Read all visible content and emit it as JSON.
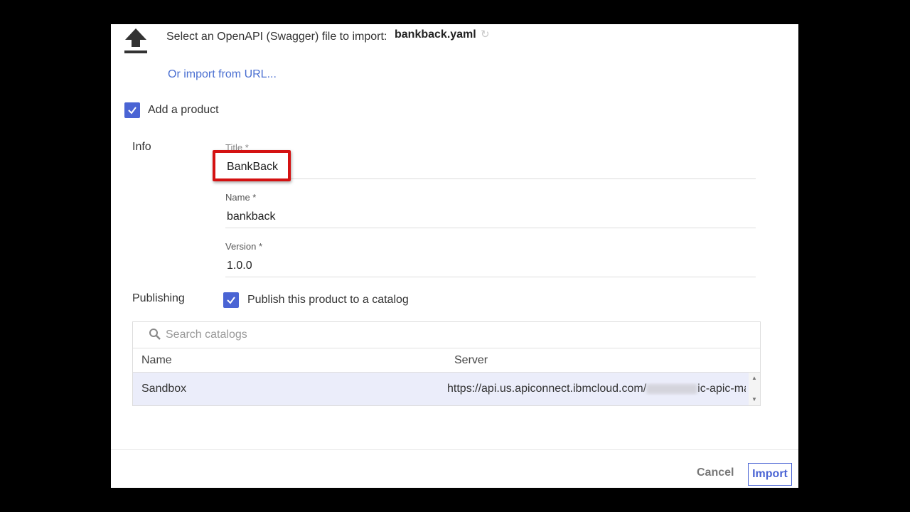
{
  "import": {
    "label": "Select an OpenAPI (Swagger) file to import:",
    "filename": "bankback.yaml",
    "url_link": "Or import from URL..."
  },
  "product": {
    "add_label": "Add a product",
    "add_checked": true
  },
  "info": {
    "section_label": "Info",
    "title_label": "Title *",
    "title_value": "BankBack",
    "name_label": "Name *",
    "name_value": "bankback",
    "version_label": "Version *",
    "version_value": "1.0.0"
  },
  "publishing": {
    "section_label": "Publishing",
    "publish_label": "Publish this product to a catalog",
    "publish_checked": true,
    "search_placeholder": "Search catalogs",
    "columns": [
      "Name",
      "Server"
    ],
    "rows": [
      {
        "name": "Sandbox",
        "server_prefix": "https://api.us.apiconnect.ibmcloud.com/",
        "server_suffix": "ic-apic-mal"
      }
    ]
  },
  "footer": {
    "cancel_label": "Cancel",
    "import_label": "Import"
  },
  "colors": {
    "accent": "#4a64d4",
    "highlight_box": "#d41111",
    "row_selected": "#ebedfa"
  }
}
